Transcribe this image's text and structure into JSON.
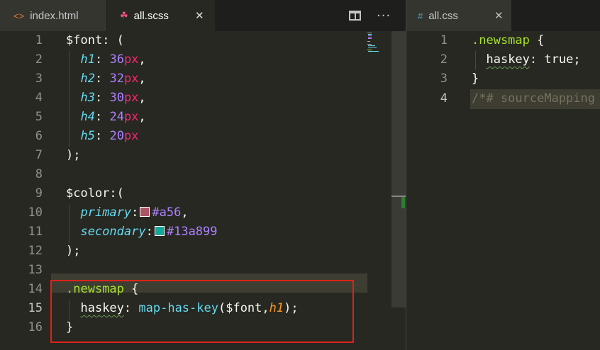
{
  "left_pane": {
    "tabs": [
      {
        "name": "index.html",
        "icon": "code-brackets-icon",
        "active": false
      },
      {
        "name": "all.scss",
        "icon": "sass-icon",
        "active": true,
        "close": "✕"
      }
    ],
    "actions": {
      "split": "split-editor-icon",
      "more": "···"
    }
  },
  "right_pane": {
    "tabs": [
      {
        "name": "all.css",
        "icon": "#",
        "active": false,
        "close": "✕"
      }
    ]
  },
  "left_lines": [
    {
      "n": "1"
    },
    {
      "n": "2"
    },
    {
      "n": "3"
    },
    {
      "n": "4"
    },
    {
      "n": "5"
    },
    {
      "n": "6"
    },
    {
      "n": "7"
    },
    {
      "n": "8"
    },
    {
      "n": "9"
    },
    {
      "n": "10"
    },
    {
      "n": "11"
    },
    {
      "n": "12"
    },
    {
      "n": "13"
    },
    {
      "n": "14"
    },
    {
      "n": "15"
    },
    {
      "n": "16"
    }
  ],
  "scss": {
    "font_var": "$font",
    "font_open": ": (",
    "keys": [
      "h1",
      "h2",
      "h3",
      "h4",
      "h5"
    ],
    "nums": [
      "36",
      "32",
      "30",
      "24",
      "20"
    ],
    "unit": "px",
    "comma": ",",
    "colon": ": ",
    "close_paren": ");",
    "color_var": "$color",
    "color_open": ":(",
    "primary_key": "primary",
    "primary_value": "#a56",
    "primary_swatch": "#aa5566",
    "secondary_key": "secondary",
    "secondary_value": "#13a899",
    "secondary_swatch": "#13a899",
    "selector": ".newsmap",
    "brace_open": " {",
    "prop": "haskey",
    "fn": "map-has-key",
    "fn_args_open": "($font,",
    "fn_arg_key": "h1",
    "fn_args_close": ");",
    "brace_close": "}"
  },
  "right_lines": [
    {
      "n": "1"
    },
    {
      "n": "2"
    },
    {
      "n": "3"
    },
    {
      "n": "4"
    }
  ],
  "css": {
    "selector": ".newsmap",
    "brace_open": " {",
    "prop": "haskey",
    "colon": ": ",
    "value": "true;",
    "brace_close": "}",
    "comment": "/*# sourceMapping"
  },
  "colors": {
    "editor_bg": "#272822",
    "highlight_box": "#e0201a",
    "current_line": "#3e3d32"
  }
}
